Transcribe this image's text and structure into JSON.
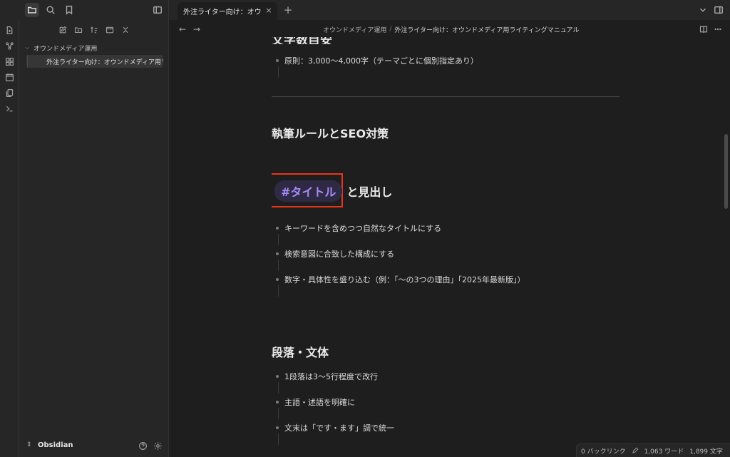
{
  "tab": {
    "title": "外注ライター向け：オウンドメディア用ライティングマニュアル",
    "close": "×",
    "add": "+"
  },
  "sidebar": {
    "folder": "オウンドメディア運用",
    "file": "外注ライター向け：オウンドメディア用ライティングマニュアル",
    "vault": "Obsidian"
  },
  "nav": {
    "back": "←",
    "forward": "→"
  },
  "breadcrumb": {
    "folder": "オウンドメディア運用",
    "separator": "/",
    "file": "外注ライター向け：オウンドメディア用ライティングマニュアル"
  },
  "document": {
    "cut_heading": "文字数目安",
    "length_bullet": "原則：3,000〜4,000字（テーマごとに個別指定あり）",
    "section_title": "執筆ルールとSEO対策",
    "title_heading": {
      "tag": "#タイトル",
      "rest": "と見出し"
    },
    "title_bullets": [
      "キーワードを含めつつ自然なタイトルにする",
      "検索意図に合致した構成にする",
      "数字・具体性を盛り込む（例：「〜の3つの理由」「2025年最新版」）"
    ],
    "paragraph_heading": "段落・文体",
    "paragraph_bullets": [
      "1段落は3〜5行程度で改行",
      "主語・述語を明確に",
      "文末は「です・ます」調で統一"
    ]
  },
  "status": {
    "backlinks": "0 バックリンク",
    "words": "1,063 ワード",
    "chars": "1,899 文字"
  },
  "colors": {
    "accent_tag": "#a88bfa",
    "highlight_box": "#e8341c",
    "sync_error": "#e5484d"
  }
}
